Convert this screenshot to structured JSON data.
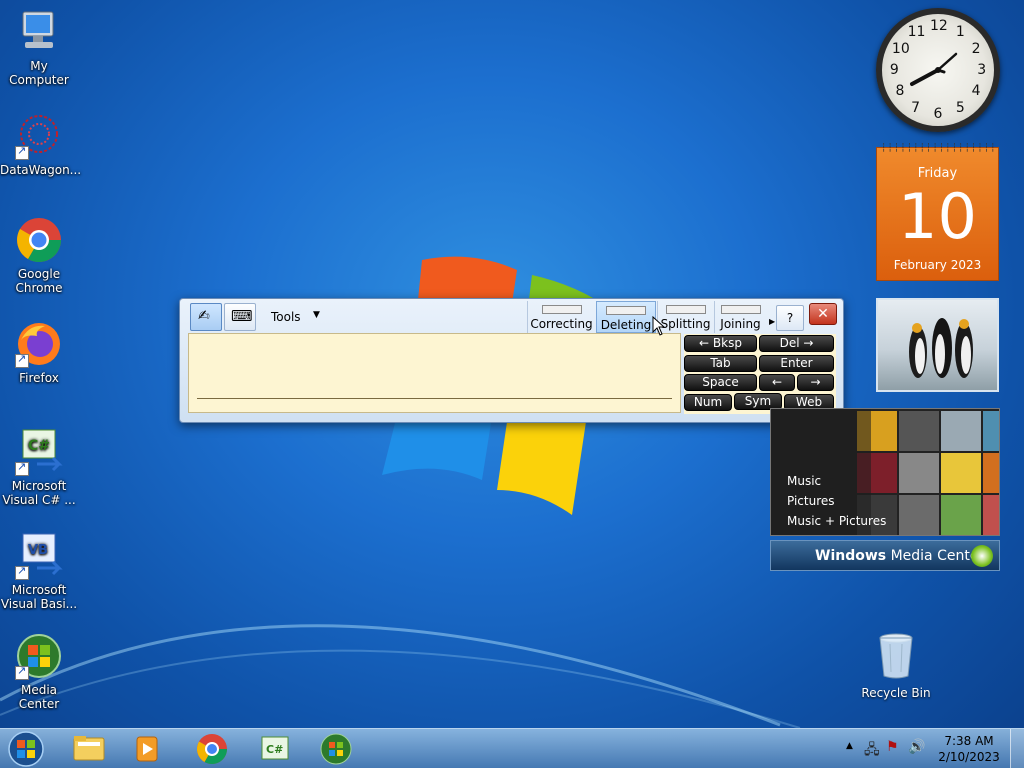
{
  "desktop_icons": [
    {
      "label": "My Computer"
    },
    {
      "label": "DataWagon..."
    },
    {
      "label": "Google Chrome"
    },
    {
      "label": "Firefox"
    },
    {
      "label": "Microsoft Visual C# ..."
    },
    {
      "label": "Microsoft Visual Basi..."
    },
    {
      "label": "Media Center"
    }
  ],
  "recycle_bin": {
    "label": "Recycle Bin"
  },
  "tip": {
    "tools_label": "Tools",
    "gestures": [
      "Correcting",
      "Deleting",
      "Splitting",
      "Joining"
    ],
    "close_label": "✕",
    "keys": {
      "bksp": "←   Bksp",
      "del": "Del    →",
      "tab": "Tab",
      "enter": "Enter",
      "space": "Space",
      "left": "←",
      "right": "→",
      "num": "Num",
      "sym": "Sym",
      "web": "Web"
    }
  },
  "clock": {
    "numbers": [
      "12",
      "1",
      "2",
      "3",
      "4",
      "5",
      "6",
      "7",
      "8",
      "9",
      "10",
      "11"
    ]
  },
  "calendar": {
    "day": "Friday",
    "date": "10",
    "month": "February 2023"
  },
  "media_center": {
    "items": [
      "Music",
      "Pictures",
      "Music + Pictures"
    ],
    "brand_bold": "Windows",
    "brand_rest": " Media Center"
  },
  "taskbar": {
    "time": "7:38 AM",
    "date": "2/10/2023"
  },
  "colors": {
    "accent": "#1c6fcf",
    "calendar": "#e86f18",
    "close": "#c3341d"
  }
}
